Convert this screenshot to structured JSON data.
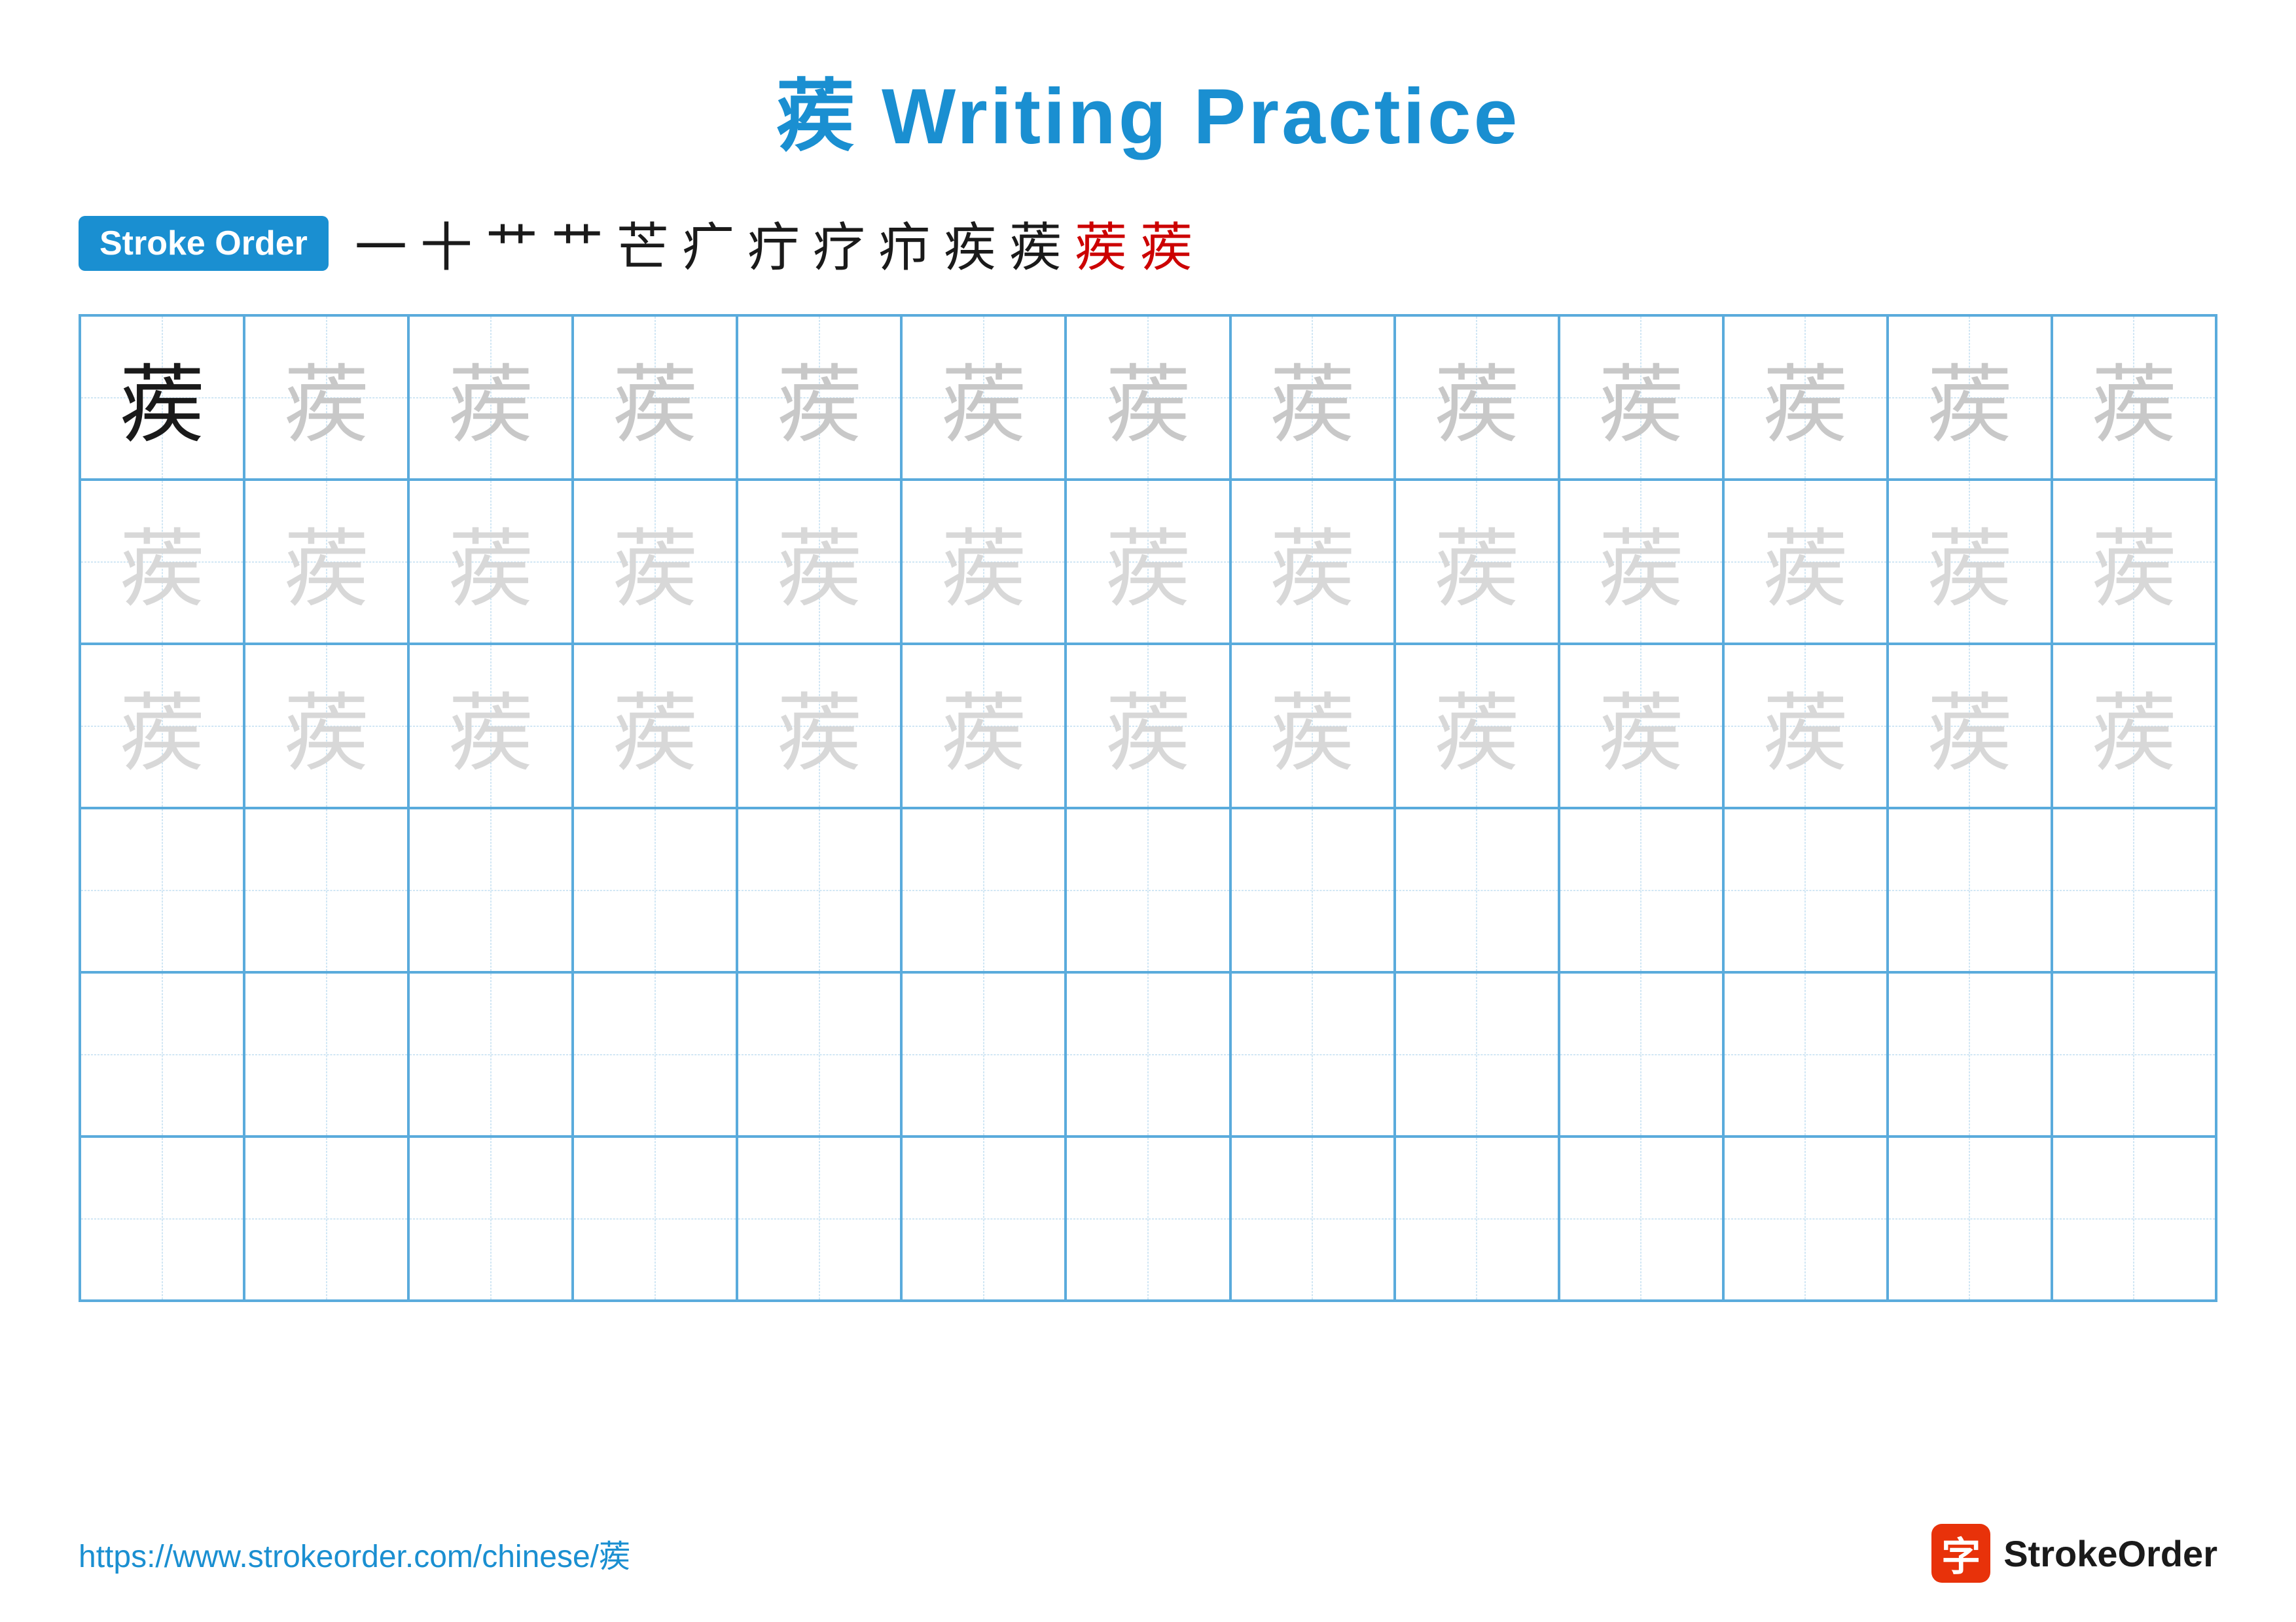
{
  "title": "蒺 Writing Practice",
  "stroke_order_badge": "Stroke Order",
  "stroke_sequence": [
    {
      "char": "一",
      "red": false
    },
    {
      "char": "十",
      "red": false
    },
    {
      "char": "艹",
      "red": false
    },
    {
      "char": "艹",
      "red": false
    },
    {
      "char": "芒",
      "red": false
    },
    {
      "char": "疒",
      "red": false
    },
    {
      "char": "疔",
      "red": false
    },
    {
      "char": "疗",
      "red": false
    },
    {
      "char": "疖",
      "red": false
    },
    {
      "char": "疾",
      "red": false
    },
    {
      "char": "蒺",
      "red": false
    },
    {
      "char": "蒺",
      "red": true
    },
    {
      "char": "蒺",
      "red": true
    }
  ],
  "grid": {
    "rows": [
      {
        "cells": [
          {
            "char": "蒺",
            "style": "dark"
          },
          {
            "char": "蒺",
            "style": "light1"
          },
          {
            "char": "蒺",
            "style": "light1"
          },
          {
            "char": "蒺",
            "style": "light1"
          },
          {
            "char": "蒺",
            "style": "light1"
          },
          {
            "char": "蒺",
            "style": "light1"
          },
          {
            "char": "蒺",
            "style": "light1"
          },
          {
            "char": "蒺",
            "style": "light1"
          },
          {
            "char": "蒺",
            "style": "light1"
          },
          {
            "char": "蒺",
            "style": "light1"
          },
          {
            "char": "蒺",
            "style": "light1"
          },
          {
            "char": "蒺",
            "style": "light1"
          },
          {
            "char": "蒺",
            "style": "light1"
          }
        ]
      },
      {
        "cells": [
          {
            "char": "蒺",
            "style": "light2"
          },
          {
            "char": "蒺",
            "style": "light2"
          },
          {
            "char": "蒺",
            "style": "light2"
          },
          {
            "char": "蒺",
            "style": "light2"
          },
          {
            "char": "蒺",
            "style": "light2"
          },
          {
            "char": "蒺",
            "style": "light2"
          },
          {
            "char": "蒺",
            "style": "light2"
          },
          {
            "char": "蒺",
            "style": "light2"
          },
          {
            "char": "蒺",
            "style": "light2"
          },
          {
            "char": "蒺",
            "style": "light2"
          },
          {
            "char": "蒺",
            "style": "light2"
          },
          {
            "char": "蒺",
            "style": "light2"
          },
          {
            "char": "蒺",
            "style": "light2"
          }
        ]
      },
      {
        "cells": [
          {
            "char": "蒺",
            "style": "light2"
          },
          {
            "char": "蒺",
            "style": "light2"
          },
          {
            "char": "蒺",
            "style": "light2"
          },
          {
            "char": "蒺",
            "style": "light2"
          },
          {
            "char": "蒺",
            "style": "light2"
          },
          {
            "char": "蒺",
            "style": "light2"
          },
          {
            "char": "蒺",
            "style": "light2"
          },
          {
            "char": "蒺",
            "style": "light2"
          },
          {
            "char": "蒺",
            "style": "light2"
          },
          {
            "char": "蒺",
            "style": "light2"
          },
          {
            "char": "蒺",
            "style": "light2"
          },
          {
            "char": "蒺",
            "style": "light2"
          },
          {
            "char": "蒺",
            "style": "light2"
          }
        ]
      },
      {
        "cells": [
          {
            "char": "",
            "style": "empty"
          },
          {
            "char": "",
            "style": "empty"
          },
          {
            "char": "",
            "style": "empty"
          },
          {
            "char": "",
            "style": "empty"
          },
          {
            "char": "",
            "style": "empty"
          },
          {
            "char": "",
            "style": "empty"
          },
          {
            "char": "",
            "style": "empty"
          },
          {
            "char": "",
            "style": "empty"
          },
          {
            "char": "",
            "style": "empty"
          },
          {
            "char": "",
            "style": "empty"
          },
          {
            "char": "",
            "style": "empty"
          },
          {
            "char": "",
            "style": "empty"
          },
          {
            "char": "",
            "style": "empty"
          }
        ]
      },
      {
        "cells": [
          {
            "char": "",
            "style": "empty"
          },
          {
            "char": "",
            "style": "empty"
          },
          {
            "char": "",
            "style": "empty"
          },
          {
            "char": "",
            "style": "empty"
          },
          {
            "char": "",
            "style": "empty"
          },
          {
            "char": "",
            "style": "empty"
          },
          {
            "char": "",
            "style": "empty"
          },
          {
            "char": "",
            "style": "empty"
          },
          {
            "char": "",
            "style": "empty"
          },
          {
            "char": "",
            "style": "empty"
          },
          {
            "char": "",
            "style": "empty"
          },
          {
            "char": "",
            "style": "empty"
          },
          {
            "char": "",
            "style": "empty"
          }
        ]
      },
      {
        "cells": [
          {
            "char": "",
            "style": "empty"
          },
          {
            "char": "",
            "style": "empty"
          },
          {
            "char": "",
            "style": "empty"
          },
          {
            "char": "",
            "style": "empty"
          },
          {
            "char": "",
            "style": "empty"
          },
          {
            "char": "",
            "style": "empty"
          },
          {
            "char": "",
            "style": "empty"
          },
          {
            "char": "",
            "style": "empty"
          },
          {
            "char": "",
            "style": "empty"
          },
          {
            "char": "",
            "style": "empty"
          },
          {
            "char": "",
            "style": "empty"
          },
          {
            "char": "",
            "style": "empty"
          },
          {
            "char": "",
            "style": "empty"
          }
        ]
      }
    ]
  },
  "footer": {
    "url": "https://www.strokeorder.com/chinese/蒺",
    "logo_char": "字",
    "logo_text": "StrokeOrder"
  }
}
